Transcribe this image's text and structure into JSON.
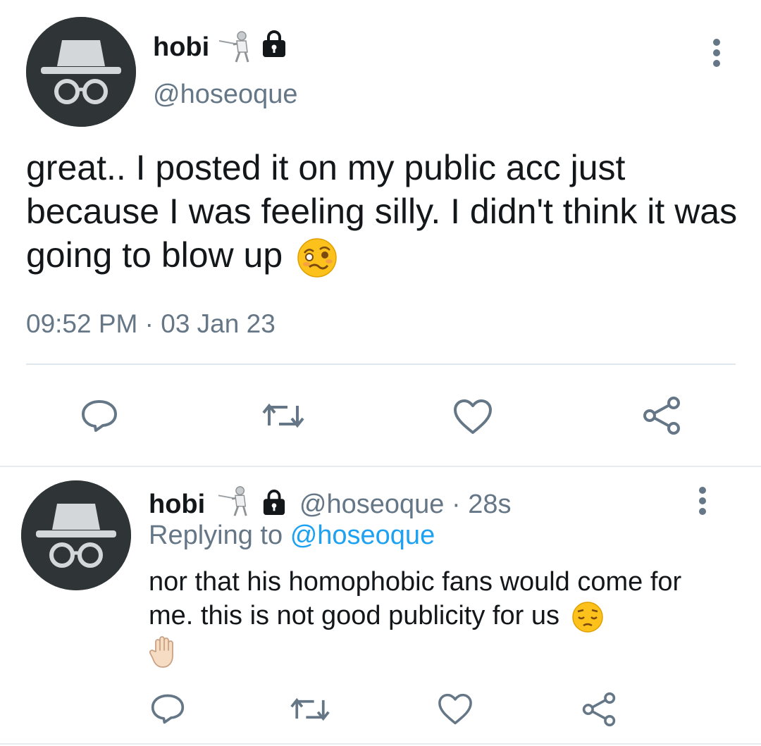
{
  "main_tweet": {
    "display_name": "hobi",
    "handle": "@hoseoque",
    "text": "great.. I posted it on my public acc just because I was feeling silly. I didn't think it was going to blow up",
    "text_emoji": "woozy-face-emoji",
    "timestamp": "09:52 PM · 03 Jan 23",
    "icons": {
      "badge": "fencer-emoji",
      "lock": "lock-icon",
      "menu": "more-vertical-icon",
      "actions": [
        "reply-icon",
        "retweet-icon",
        "like-icon",
        "share-icon"
      ]
    }
  },
  "reply_tweet": {
    "display_name": "hobi",
    "handle": "@hoseoque",
    "separator": "·",
    "time_ago": "28s",
    "replying_prefix": "Replying to",
    "replying_handle": "@hoseoque",
    "text": "nor that his homophobic fans would come for me. this is not good publicity for us",
    "text_emojis": [
      "pensive-face-emoji",
      "raised-hand-emoji"
    ],
    "icons": {
      "badge": "fencer-emoji",
      "lock": "lock-icon",
      "menu": "more-vertical-icon",
      "actions": [
        "reply-icon",
        "retweet-icon",
        "like-icon",
        "share-icon"
      ]
    }
  },
  "colors": {
    "text": "#14171a",
    "muted": "#657786",
    "link": "#1da1f2",
    "avatar_bg": "#2f3437",
    "divider": "#e1e8ed"
  }
}
